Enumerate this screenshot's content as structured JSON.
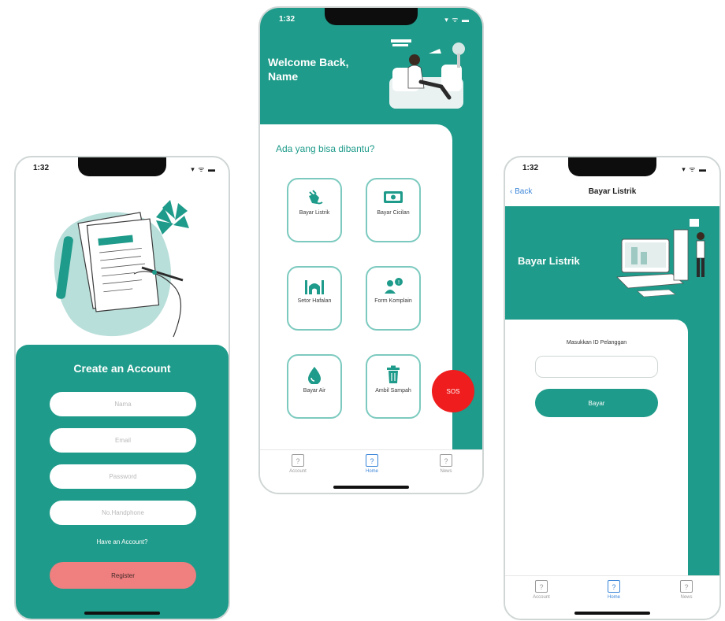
{
  "colors": {
    "teal": "#1e9b8a",
    "coral": "#f07f7f",
    "sos_red": "#ef1d1d",
    "tab_active": "#3a86d8"
  },
  "status": {
    "time": "1:32",
    "icons": "▾ ᯤ ▬"
  },
  "register_screen": {
    "title": "Create an Account",
    "fields": [
      {
        "placeholder": "Nama"
      },
      {
        "placeholder": "Email"
      },
      {
        "placeholder": "Password"
      },
      {
        "placeholder": "No.Handphone"
      }
    ],
    "have_account": "Have an Account?",
    "register_label": "Register",
    "illustration": "notebook-writing-illustration"
  },
  "home_screen": {
    "welcome": "Welcome Back, Name",
    "help_title": "Ada yang bisa dibantu?",
    "illustration": "person-relaxing-illustration",
    "menu": [
      {
        "label": "Bayar Listrik",
        "icon": "plug-icon"
      },
      {
        "label": "Bayar Cicilan",
        "icon": "money-icon"
      },
      {
        "label": "Setor Hafalan",
        "icon": "mosque-icon"
      },
      {
        "label": "Form Komplain",
        "icon": "complaint-icon"
      },
      {
        "label": "Bayar Air",
        "icon": "water-drop-icon"
      },
      {
        "label": "Ambil Sampah",
        "icon": "trash-icon"
      }
    ],
    "sos_label": "SOS"
  },
  "tabs": [
    {
      "label": "Account",
      "glyph": "?"
    },
    {
      "label": "Home",
      "glyph": "?"
    },
    {
      "label": "News",
      "glyph": "?"
    }
  ],
  "bill_screen": {
    "back_label": "Back",
    "nav_title": "Bayar Listrik",
    "header_title": "Bayar Listrik",
    "illustration": "computer-workstation-illustration",
    "id_label": "Masukkan ID Pelanggan",
    "id_value": "",
    "pay_label": "Bayar"
  }
}
